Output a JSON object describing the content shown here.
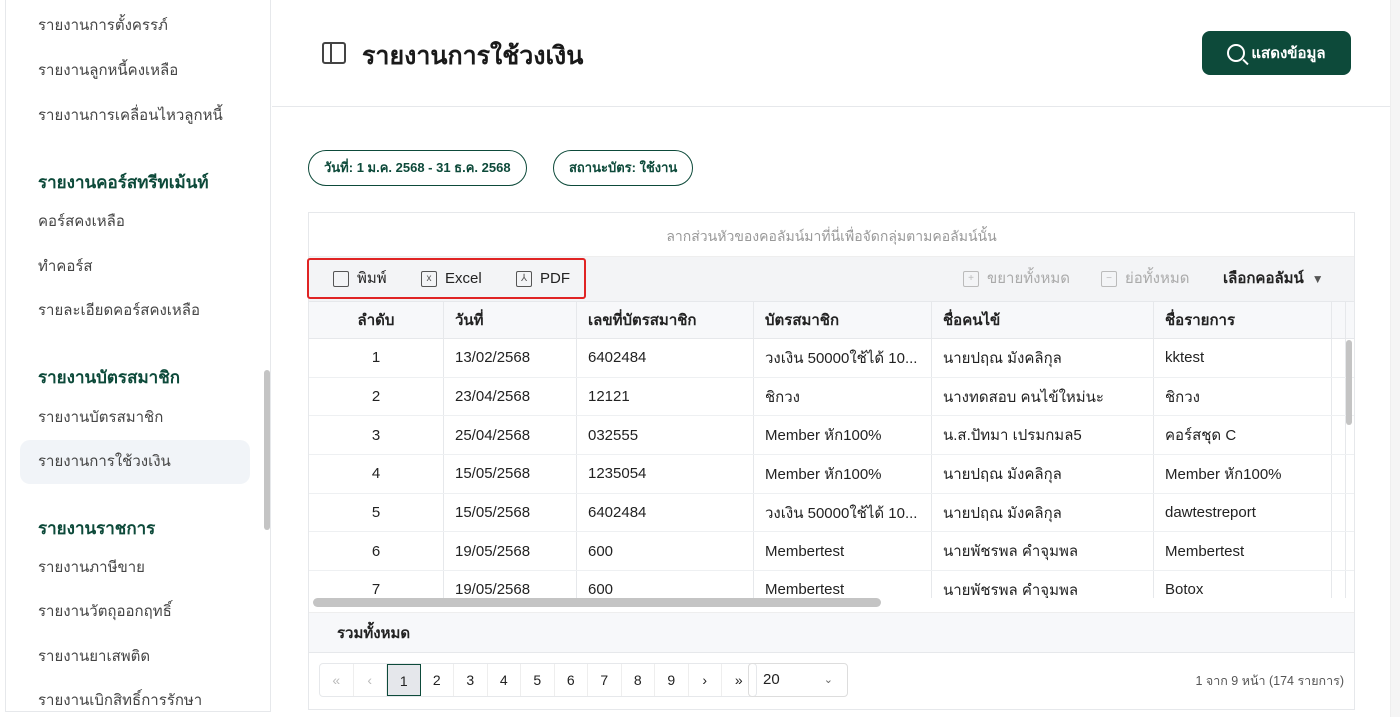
{
  "sidebar": {
    "items_top": [
      "รายงานการตั้งครรภ์",
      "รายงานลูกหนี้คงเหลือ",
      "รายงานการเคลื่อนไหวลูกหนี้"
    ],
    "section_course": {
      "title": "รายงานคอร์สทรีทเม้นท์",
      "items": [
        "คอร์สคงเหลือ",
        "ทำคอร์ส",
        "รายละเอียดคอร์สคงเหลือ"
      ]
    },
    "section_member": {
      "title": "รายงานบัตรสมาชิก",
      "items": [
        "รายงานบัตรสมาชิก",
        "รายงานการใช้วงเงิน"
      ]
    },
    "section_gov": {
      "title": "รายงานราชการ",
      "items": [
        "รายงานภาษีขาย",
        "รายงานวัตถุออกฤทธิ์",
        "รายงานยาเสพติด",
        "รายงานเบิกสิทธิ์การรักษา"
      ]
    }
  },
  "header": {
    "title": "รายงานการใช้วงเงิน",
    "show_button": "แสดงข้อมูล"
  },
  "filters": [
    "วันที่: 1 ม.ค. 2568 - 31 ธ.ค. 2568",
    "สถานะบัตร: ใช้งาน"
  ],
  "grid": {
    "group_panel": "ลากส่วนหัวของคอลัมน์มาที่นี่เพื่อจัดกลุ่มตามคอลัมน์นั้น",
    "toolbar": {
      "print": "พิมพ์",
      "excel": "Excel",
      "pdf": "PDF",
      "expand_all": "ขยายทั้งหมด",
      "collapse_all": "ย่อทั้งหมด",
      "choose_columns": "เลือกคอลัมน์"
    },
    "columns": [
      "ลำดับ",
      "วันที่",
      "เลขที่บัตรสมาชิก",
      "บัตรสมาชิก",
      "ชื่อคนไข้",
      "ชื่อรายการ"
    ],
    "rows": [
      [
        "1",
        "13/02/2568",
        "6402484",
        "วงเงิน 50000ใช้ได้ 10...",
        "นายปฤณ มังคลิกุล",
        "kktest"
      ],
      [
        "2",
        "23/04/2568",
        "12121",
        "ชิกวง",
        "นางทดสอบ คนไข้ใหม่นะ",
        "ชิกวง"
      ],
      [
        "3",
        "25/04/2568",
        "032555",
        "Member หัก100%",
        "น.ส.ปัทมา เปรมกมล5",
        "คอร์สชุด C"
      ],
      [
        "4",
        "15/05/2568",
        "1235054",
        "Member หัก100%",
        "นายปฤณ มังคลิกุล",
        "Member หัก100%"
      ],
      [
        "5",
        "15/05/2568",
        "6402484",
        "วงเงิน 50000ใช้ได้ 10...",
        "นายปฤณ มังคลิกุล",
        "dawtestreport"
      ],
      [
        "6",
        "19/05/2568",
        "600",
        "Membertest",
        "นายพัชรพล คำจุมพล",
        "Membertest"
      ],
      [
        "7",
        "19/05/2568",
        "600",
        "Membertest",
        "นายพัชรพล คำจุมพล",
        "Botox"
      ]
    ],
    "summary": "รวมทั้งหมด",
    "pager": {
      "first": "«",
      "prev": "‹",
      "pages": [
        "1",
        "2",
        "3",
        "4",
        "5",
        "6",
        "7",
        "8",
        "9"
      ],
      "current": "1",
      "next": "›",
      "last": "»",
      "page_size": "20",
      "info": "1 จาก 9 หน้า (174 รายการ)"
    }
  }
}
